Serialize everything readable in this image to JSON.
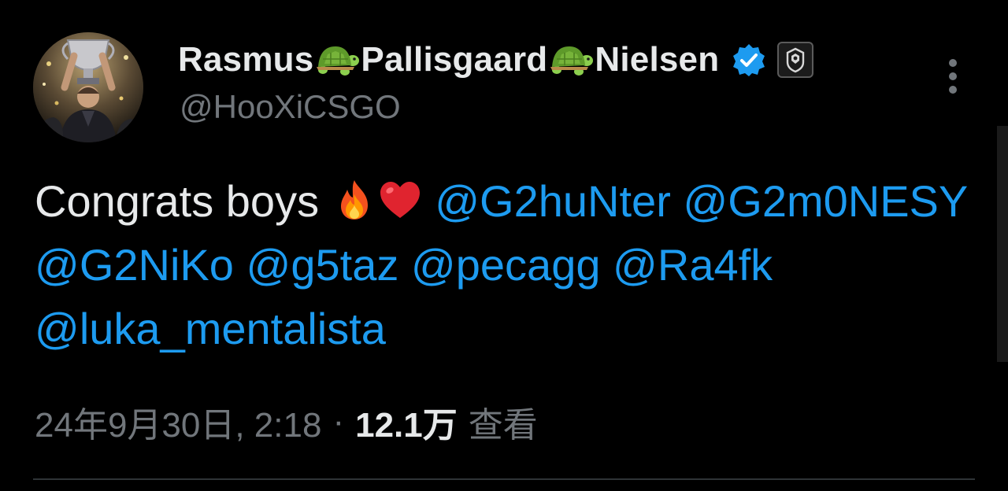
{
  "author": {
    "name_parts": [
      "Rasmus",
      "Pallisgaard",
      "Nielsen"
    ],
    "name_separator_icon": "turtle-emoji",
    "handle": "@HooXiCSGO",
    "verified_icon": "verified-badge-icon",
    "affiliate_icon": "g2-esports-logo",
    "verified_color": "#1d9bf0"
  },
  "tweet": {
    "text_prefix": "Congrats boys ",
    "emojis": [
      "fire-emoji",
      "red-heart-emoji"
    ],
    "mentions": [
      "@G2huNter",
      "@G2m0NESY",
      "@G2NiKo",
      "@g5taz",
      "@pecagg",
      "@Ra4fk",
      "@luka_mentalista"
    ],
    "mention_color": "#1d9bf0"
  },
  "meta": {
    "timestamp": "24年9月30日, 2:18",
    "separator": "·",
    "views_count": "12.1万",
    "views_label": "查看"
  },
  "actions": {
    "more_icon": "more-vertical-icon"
  }
}
